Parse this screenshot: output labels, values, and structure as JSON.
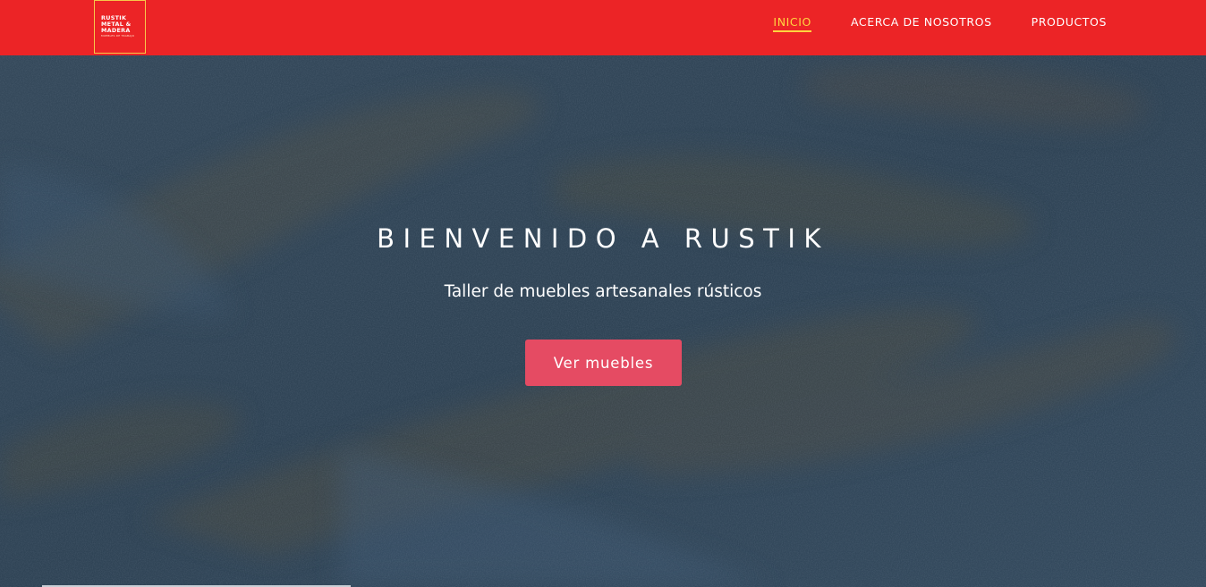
{
  "brand": {
    "logo_lines": [
      "RUSTIK",
      "METAL &",
      "MADERA"
    ],
    "logo_tagline": "MUEBLES DE TRABAJO"
  },
  "nav": {
    "items": [
      {
        "label": "INICIO",
        "active": true
      },
      {
        "label": "ACERCA DE NOSOTROS",
        "active": false
      },
      {
        "label": "PRODUCTOS",
        "active": false
      }
    ]
  },
  "hero": {
    "title": "BIENVENIDO A RUSTIK",
    "subtitle": "Taller de muebles artesanales rústicos",
    "button_label": "Ver muebles"
  },
  "colors": {
    "header_bg": "#ec2426",
    "nav_active": "#ffd540",
    "hero_overlay": "#33475a",
    "button_bg": "#e54b63"
  }
}
